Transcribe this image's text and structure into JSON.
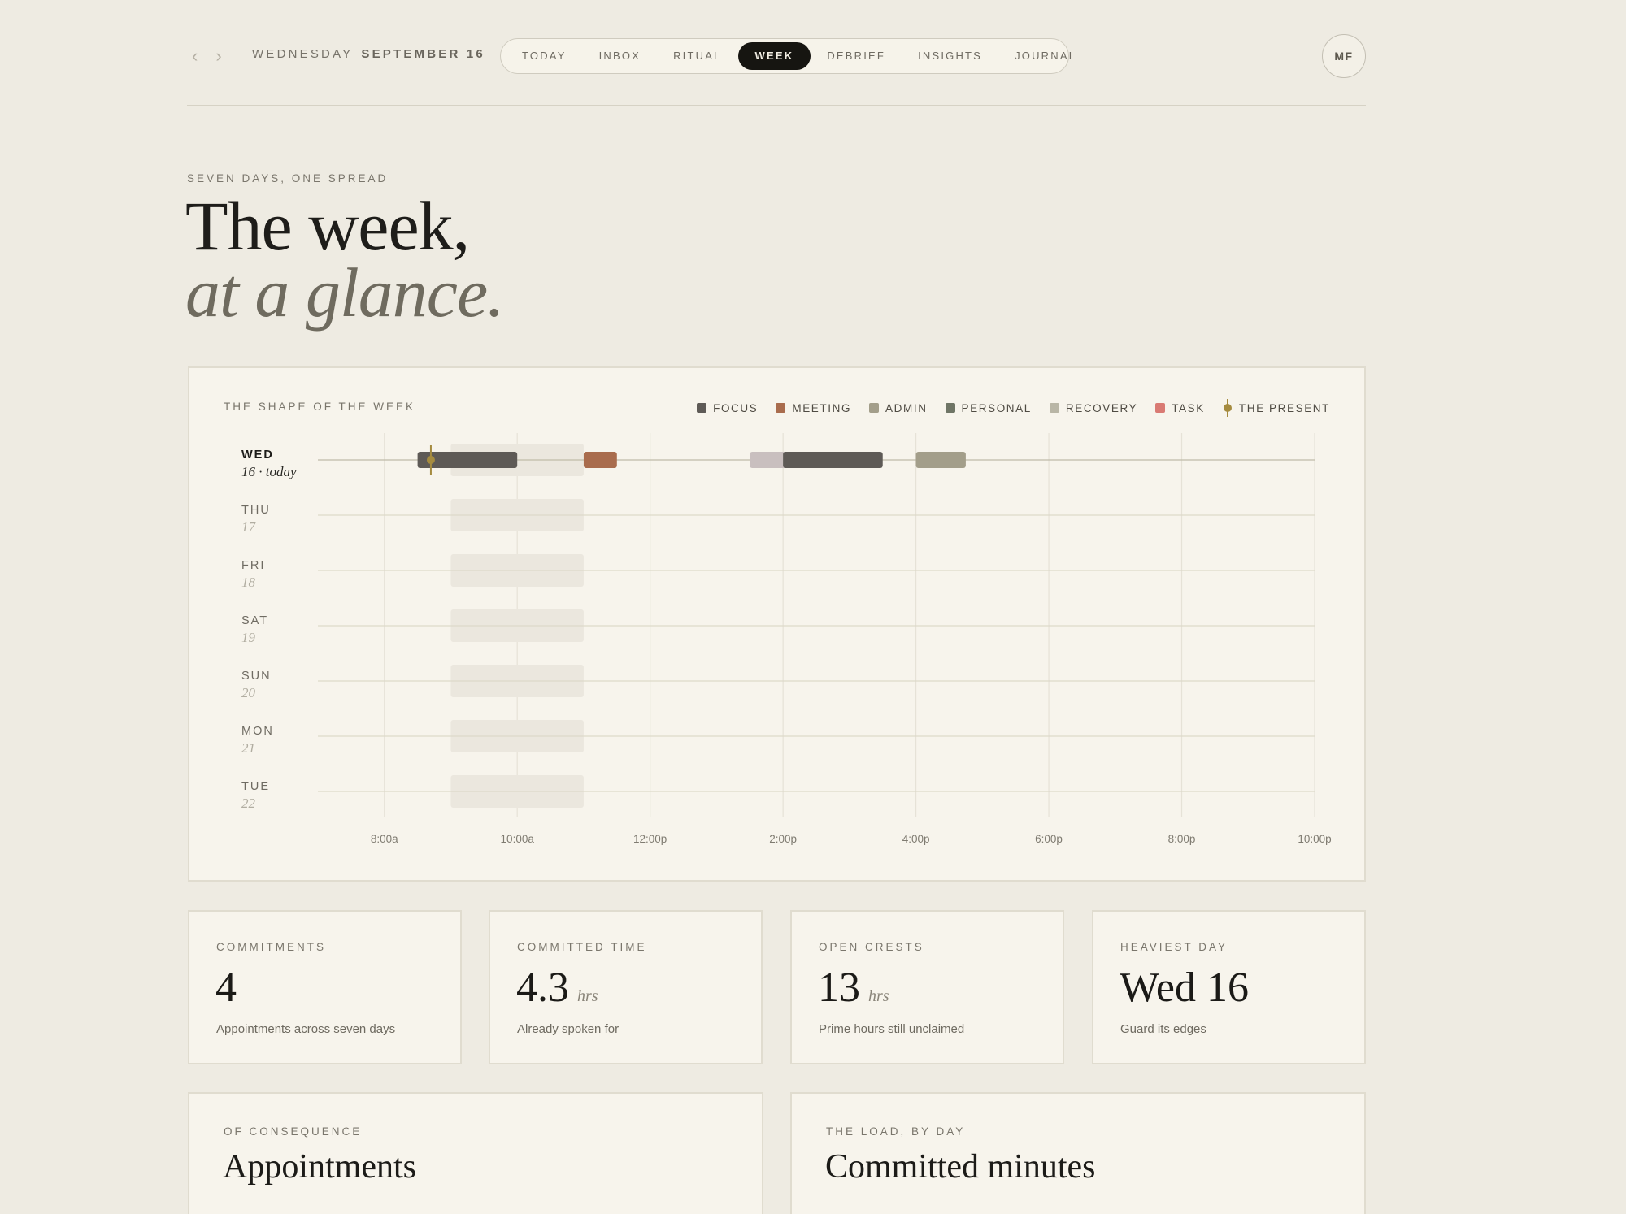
{
  "header": {
    "prev_icon": "chevron-left-icon",
    "next_icon": "chevron-right-icon",
    "weekday": "WEDNESDAY",
    "date": "SEPTEMBER 16",
    "tabs": [
      {
        "label": "TODAY",
        "active": false
      },
      {
        "label": "INBOX",
        "active": false
      },
      {
        "label": "RITUAL",
        "active": false
      },
      {
        "label": "WEEK",
        "active": true
      },
      {
        "label": "DEBRIEF",
        "active": false
      },
      {
        "label": "INSIGHTS",
        "active": false
      },
      {
        "label": "JOURNAL",
        "active": false
      }
    ],
    "avatar_initials": "MF"
  },
  "hero": {
    "eyebrow": "SEVEN DAYS, ONE SPREAD",
    "title_line1": "The week,",
    "title_line2": "at a glance."
  },
  "timeline": {
    "eyebrow": "THE SHAPE OF THE WEEK",
    "legend": [
      {
        "label": "FOCUS",
        "color": "#5e5a56"
      },
      {
        "label": "MEETING",
        "color": "#a96c4d"
      },
      {
        "label": "ADMIN",
        "color": "#a39e8a"
      },
      {
        "label": "PERSONAL",
        "color": "#6f7566"
      },
      {
        "label": "RECOVERY",
        "color": "#b9b6a6"
      },
      {
        "label": "TASK",
        "color": "#d97a73"
      },
      {
        "label": "THE PRESENT",
        "color": "#a58b3f",
        "marker": true
      }
    ],
    "hour_range": [
      7,
      22
    ],
    "hour_ticks": [
      {
        "hour": 8,
        "label": "8:00a"
      },
      {
        "hour": 10,
        "label": "10:00a"
      },
      {
        "hour": 12,
        "label": "12:00p"
      },
      {
        "hour": 14,
        "label": "2:00p"
      },
      {
        "hour": 16,
        "label": "4:00p"
      },
      {
        "hour": 18,
        "label": "6:00p"
      },
      {
        "hour": 20,
        "label": "8:00p"
      },
      {
        "hour": 22,
        "label": "10:00p"
      }
    ],
    "prime_window": [
      9,
      11
    ],
    "present_hour": 8.7,
    "days": [
      {
        "day": "WED",
        "date": "16 · today",
        "today": true,
        "events": [
          {
            "start": 8.5,
            "end": 10.0,
            "color": "#5e5a56"
          },
          {
            "start": 11.0,
            "end": 11.5,
            "color": "#a96c4d"
          },
          {
            "start": 13.5,
            "end": 14.25,
            "color": "#c9bfbf"
          },
          {
            "start": 14.0,
            "end": 15.5,
            "color": "#5e5a56"
          },
          {
            "start": 16.0,
            "end": 16.75,
            "color": "#a39e8a"
          }
        ]
      },
      {
        "day": "THU",
        "date": "17",
        "today": false,
        "events": []
      },
      {
        "day": "FRI",
        "date": "18",
        "today": false,
        "events": []
      },
      {
        "day": "SAT",
        "date": "19",
        "today": false,
        "events": []
      },
      {
        "day": "SUN",
        "date": "20",
        "today": false,
        "events": []
      },
      {
        "day": "MON",
        "date": "21",
        "today": false,
        "events": []
      },
      {
        "day": "TUE",
        "date": "22",
        "today": false,
        "events": []
      }
    ]
  },
  "stats": [
    {
      "label": "COMMITMENTS",
      "value": "4",
      "unit": "",
      "note": "Appointments across seven days"
    },
    {
      "label": "COMMITTED TIME",
      "value": "4.3",
      "unit": "hrs",
      "note": "Already spoken for"
    },
    {
      "label": "OPEN CRESTS",
      "value": "13",
      "unit": "hrs",
      "note": "Prime hours still unclaimed"
    },
    {
      "label": "HEAVIEST DAY",
      "value": "Wed 16",
      "unit": "",
      "note": "Guard its edges"
    }
  ],
  "panels": [
    {
      "eyebrow": "OF CONSEQUENCE",
      "title": "Appointments"
    },
    {
      "eyebrow": "THE LOAD, BY DAY",
      "title": "Committed minutes"
    }
  ]
}
